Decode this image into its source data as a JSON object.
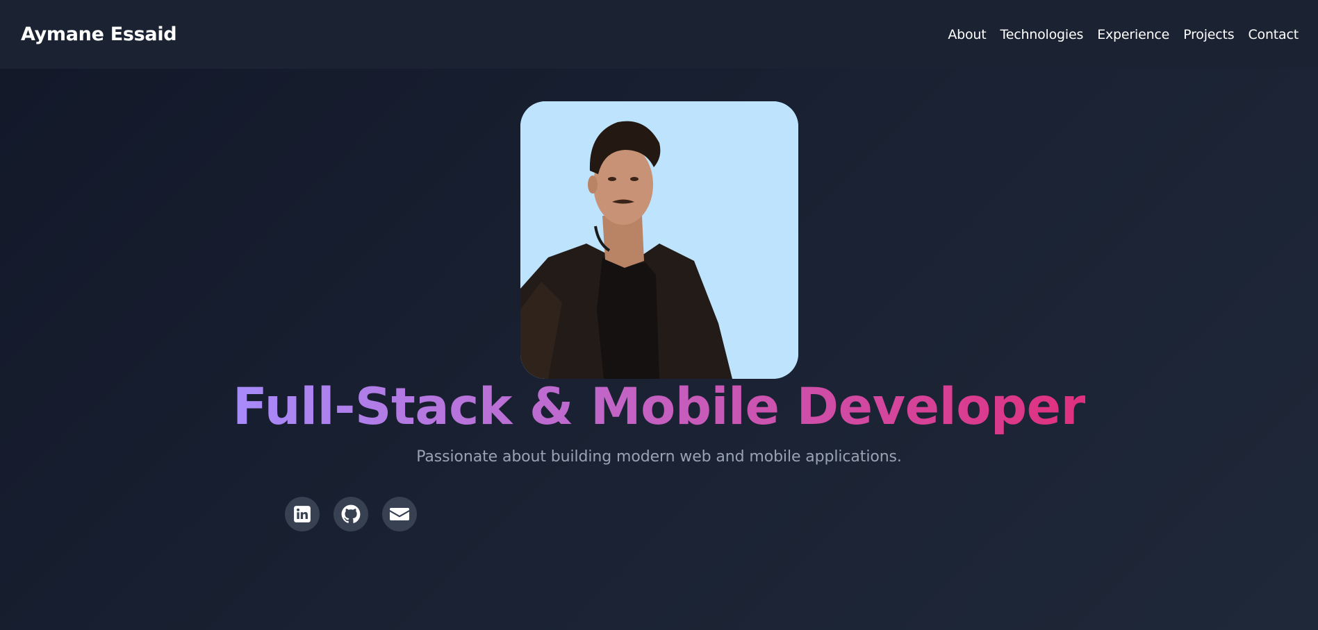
{
  "brand": {
    "name": "Aymane Essaid"
  },
  "nav": {
    "items": [
      {
        "label": "About"
      },
      {
        "label": "Technologies"
      },
      {
        "label": "Experience"
      },
      {
        "label": "Projects"
      },
      {
        "label": "Contact"
      }
    ]
  },
  "hero": {
    "headline": "Full-Stack & Mobile Developer",
    "subtitle": "Passionate about building modern web and mobile applications."
  },
  "socials": [
    {
      "icon": "linkedin-icon"
    },
    {
      "icon": "github-icon"
    },
    {
      "icon": "mail-icon"
    }
  ],
  "colors": {
    "background": "#141b2b",
    "navbar": "#1b2333",
    "gradient_start": "#a78bfa",
    "gradient_end": "#e0307e",
    "subtitle": "#9aa3b2",
    "social_bg": "#374151",
    "photo_bg": "#bee3fd"
  }
}
